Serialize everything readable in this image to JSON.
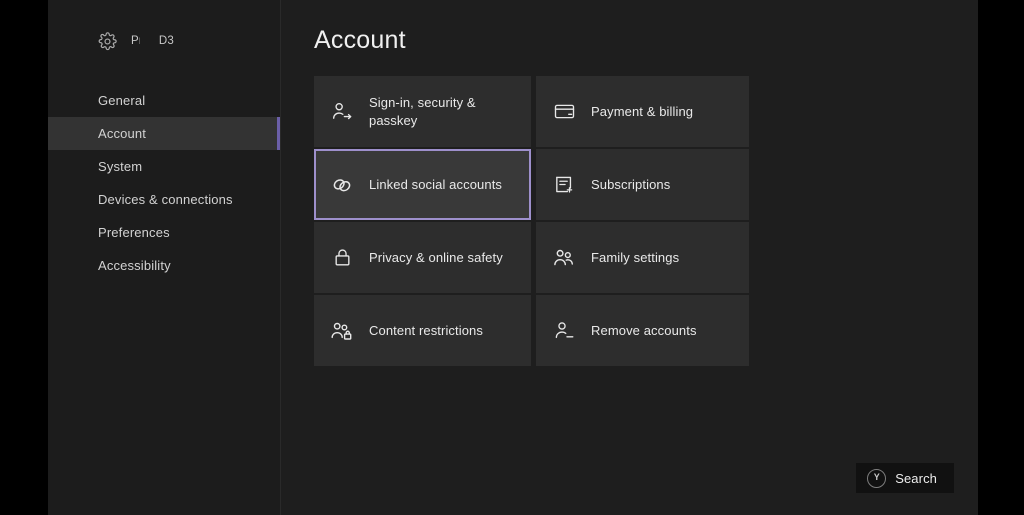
{
  "sidebar": {
    "header": {
      "gear_icon": "gear-icon",
      "fragment_1": "Pr",
      "fragment_2": "D3"
    },
    "items": [
      {
        "label": "General",
        "selected": false
      },
      {
        "label": "Account",
        "selected": true
      },
      {
        "label": "System",
        "selected": false
      },
      {
        "label": "Devices & connections",
        "selected": false
      },
      {
        "label": "Preferences",
        "selected": false
      },
      {
        "label": "Accessibility",
        "selected": false
      }
    ]
  },
  "content": {
    "title": "Account",
    "tiles": [
      {
        "label": "Sign-in, security & passkey",
        "icon": "person-arrow-icon",
        "focused": false
      },
      {
        "label": "Payment & billing",
        "icon": "credit-card-icon",
        "focused": false
      },
      {
        "label": "Linked social accounts",
        "icon": "link-chain-icon",
        "focused": true
      },
      {
        "label": "Subscriptions",
        "icon": "document-plus-icon",
        "focused": false
      },
      {
        "label": "Privacy & online safety",
        "icon": "lock-icon",
        "focused": false
      },
      {
        "label": "Family settings",
        "icon": "people-icon",
        "focused": false
      },
      {
        "label": "Content restrictions",
        "icon": "people-lock-icon",
        "focused": false
      },
      {
        "label": "Remove accounts",
        "icon": "person-minus-icon",
        "focused": false
      }
    ]
  },
  "search_button": {
    "glyph": "Y",
    "label": "Search"
  },
  "colors": {
    "focus_border": "#9e90cc",
    "sidebar_accent": "#6b5fa8",
    "tile_background": "#2d2d2d",
    "app_background": "#1e1e1e",
    "sidebar_background": "#1c1c1c",
    "selected_nav_background": "#333333"
  }
}
